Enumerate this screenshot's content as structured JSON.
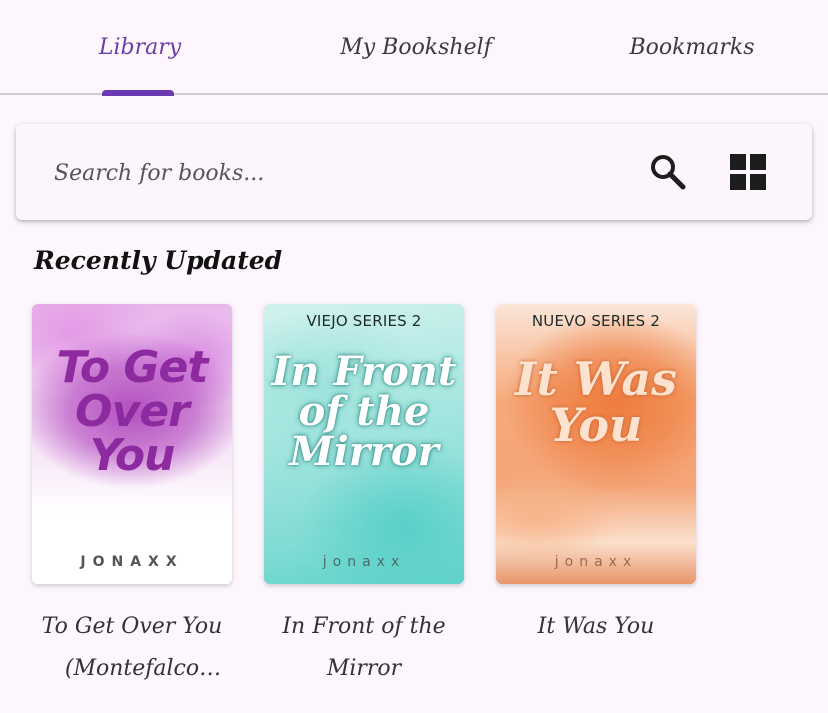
{
  "tabs": [
    {
      "label": "Library",
      "active": true
    },
    {
      "label": "My Bookshelf",
      "active": false
    },
    {
      "label": "Bookmarks",
      "active": false
    }
  ],
  "search": {
    "placeholder": "Search for books...",
    "search_icon": "search-icon",
    "view_toggle_icon": "grid-view-icon"
  },
  "section": {
    "title": "Recently Updated"
  },
  "books": [
    {
      "title": "To Get Over You (Montefalco Series)",
      "cover_series": "",
      "cover_title": "To Get Over You",
      "cover_author": "JONAXX"
    },
    {
      "title": "In Front of the Mirror",
      "cover_series": "VIEJO SERIES 2",
      "cover_title": "In Front of the Mirror",
      "cover_author": "jonaxx"
    },
    {
      "title": "It Was You",
      "cover_series": "NUEVO SERIES 2",
      "cover_title": "It Was You",
      "cover_author": "jonaxx"
    }
  ],
  "colors": {
    "accent": "#6a3ab2",
    "background": "#fdf6fc",
    "divider": "#cfcfcf"
  }
}
